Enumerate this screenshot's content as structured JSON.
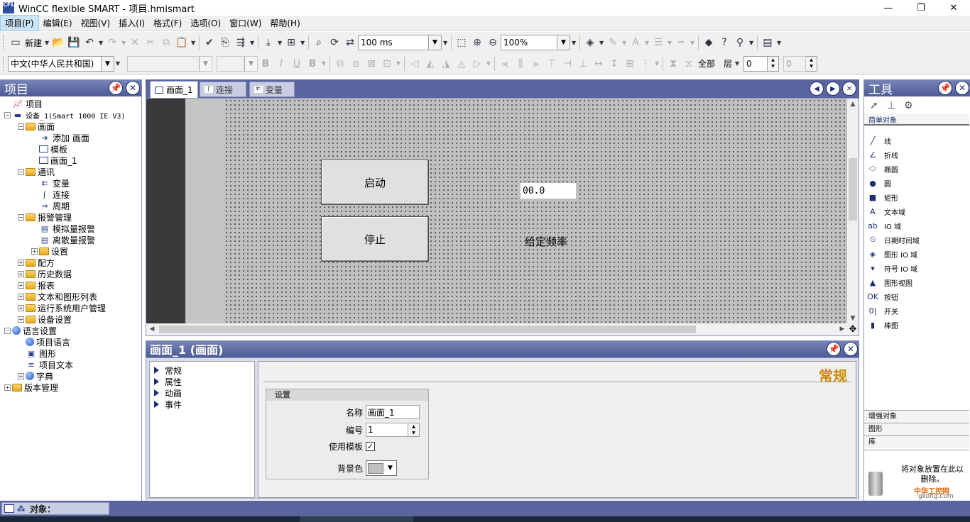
{
  "window": {
    "app_icon": "CFL",
    "title": "WinCC flexible SMART - 项目.hmismart",
    "controls": {
      "minimize": "—",
      "maximize": "❐",
      "close": "✕"
    }
  },
  "menubar": [
    "项目(P)",
    "编辑(E)",
    "视图(V)",
    "插入(I)",
    "格式(F)",
    "选项(O)",
    "窗口(W)",
    "帮助(H)"
  ],
  "toolbar1": {
    "new_label": "新建",
    "cycle_value": "100 ms",
    "zoom_value": "100%"
  },
  "toolbar2": {
    "language_value": "中文(中华人民共和国)",
    "bold": "B",
    "italic": "I",
    "underline": "U",
    "bold2": "B",
    "all_label": "全部",
    "layer_label": "层",
    "layer_value": "0",
    "layer_value2": "0"
  },
  "project_panel": {
    "title": "项目",
    "tree": [
      {
        "label": "项目",
        "level": 0,
        "icon": "project-icon",
        "expander": ""
      },
      {
        "label": "设备_1(Smart 1000 IE V3)",
        "level": 0,
        "icon": "device-icon",
        "expander": "−"
      },
      {
        "label": "画面",
        "level": 1,
        "icon": "folder-icon",
        "expander": "−"
      },
      {
        "label": "添加 画面",
        "level": 2,
        "icon": "add-screen-icon",
        "expander": ""
      },
      {
        "label": "模板",
        "level": 2,
        "icon": "screen-icon",
        "expander": ""
      },
      {
        "label": "画面_1",
        "level": 2,
        "icon": "screen-icon",
        "expander": ""
      },
      {
        "label": "通讯",
        "level": 1,
        "icon": "folder-icon",
        "expander": "−"
      },
      {
        "label": "变量",
        "level": 2,
        "icon": "tag-icon",
        "expander": ""
      },
      {
        "label": "连接",
        "level": 2,
        "icon": "connection-icon",
        "expander": ""
      },
      {
        "label": "周期",
        "level": 2,
        "icon": "cycle-icon",
        "expander": ""
      },
      {
        "label": "报警管理",
        "level": 1,
        "icon": "folder-icon",
        "expander": "−"
      },
      {
        "label": "模拟量报警",
        "level": 2,
        "icon": "alarm-icon",
        "expander": ""
      },
      {
        "label": "离散量报警",
        "level": 2,
        "icon": "alarm-icon",
        "expander": ""
      },
      {
        "label": "设置",
        "level": 2,
        "icon": "folder-icon",
        "expander": "+"
      },
      {
        "label": "配方",
        "level": 1,
        "icon": "folder-icon",
        "expander": "+"
      },
      {
        "label": "历史数据",
        "level": 1,
        "icon": "folder-icon",
        "expander": "+"
      },
      {
        "label": "报表",
        "level": 1,
        "icon": "folder-icon",
        "expander": "+"
      },
      {
        "label": "文本和图形列表",
        "level": 1,
        "icon": "folder-icon",
        "expander": "+"
      },
      {
        "label": "运行系统用户管理",
        "level": 1,
        "icon": "folder-icon",
        "expander": "+"
      },
      {
        "label": "设备设置",
        "level": 1,
        "icon": "folder-icon",
        "expander": "+"
      },
      {
        "label": "语言设置",
        "level": 0,
        "icon": "globe-icon",
        "expander": "−"
      },
      {
        "label": "项目语言",
        "level": 1,
        "icon": "globe-icon",
        "expander": ""
      },
      {
        "label": "图形",
        "level": 1,
        "icon": "graphics-icon",
        "expander": ""
      },
      {
        "label": "项目文本",
        "level": 1,
        "icon": "text-icon",
        "expander": ""
      },
      {
        "label": "字典",
        "level": 1,
        "icon": "globe-icon",
        "expander": "+"
      },
      {
        "label": "版本管理",
        "level": 0,
        "icon": "folder-icon",
        "expander": "+"
      }
    ]
  },
  "tabs": [
    {
      "label": "画面_1",
      "active": true
    },
    {
      "label": "连接",
      "active": false
    },
    {
      "label": "变量",
      "active": false
    }
  ],
  "canvas": {
    "start_button": "启动",
    "stop_button": "停止",
    "io_value": "00.0",
    "freq_label": "给定频率"
  },
  "properties": {
    "header": "画面_1 (画面)",
    "nav": [
      "常规",
      "属性",
      "动画",
      "事件"
    ],
    "section_title": "常规",
    "group_title": "设置",
    "name_label": "名称",
    "name_value": "画面_1",
    "number_label": "编号",
    "number_value": "1",
    "template_label": "使用模板",
    "template_checked": "✓",
    "bgcolor_label": "背景色"
  },
  "tools_panel": {
    "title": "工具",
    "simple_objects": "简单对象",
    "items": [
      {
        "label": "线",
        "icon": "line-icon",
        "glyph": "╱"
      },
      {
        "label": "折线",
        "icon": "polyline-icon",
        "glyph": "∠"
      },
      {
        "label": "椭圆",
        "icon": "ellipse-icon",
        "glyph": "⬭"
      },
      {
        "label": "圆",
        "icon": "circle-icon",
        "glyph": "●"
      },
      {
        "label": "矩形",
        "icon": "rectangle-icon",
        "glyph": "■"
      },
      {
        "label": "文本域",
        "icon": "text-field-icon",
        "glyph": "A"
      },
      {
        "label": "IO 域",
        "icon": "io-field-icon",
        "glyph": "ab"
      },
      {
        "label": "日期时间域",
        "icon": "datetime-field-icon",
        "glyph": "⏲"
      },
      {
        "label": "图形 IO 域",
        "icon": "graphic-io-field-icon",
        "glyph": "◈"
      },
      {
        "label": "符号 IO 域",
        "icon": "symbolic-io-field-icon",
        "glyph": "▾"
      },
      {
        "label": "图形视图",
        "icon": "graphic-view-icon",
        "glyph": "▲"
      },
      {
        "label": "按钮",
        "icon": "button-icon",
        "glyph": "OK"
      },
      {
        "label": "开关",
        "icon": "switch-icon",
        "glyph": "0|"
      },
      {
        "label": "棒图",
        "icon": "bar-icon",
        "glyph": "▮"
      }
    ],
    "enhanced_objects": "增强对象",
    "graphics": "图形",
    "library": "库",
    "hint": "将对象放置在此以删除。",
    "watermark": "中华工控网",
    "watermark_url": "gkong.com"
  },
  "statusbar": {
    "object_label": "对象："
  }
}
